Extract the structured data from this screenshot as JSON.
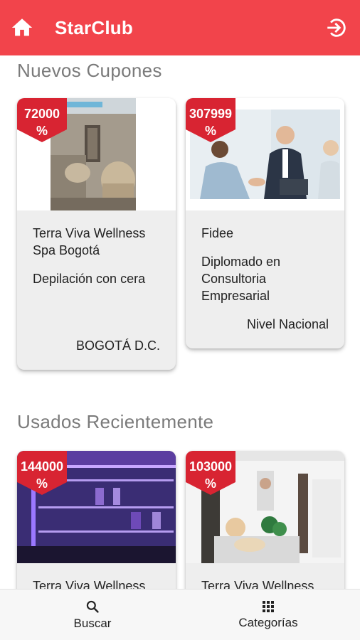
{
  "appbar": {
    "title": "StarClub",
    "home_icon": "home-icon",
    "logout_icon": "logout-icon",
    "color": "#f2444b"
  },
  "sections": {
    "new_coupons": {
      "title": "Nuevos Cupones"
    },
    "recent": {
      "title": "Usados Recientemente"
    }
  },
  "cards": [
    {
      "discount": "72000",
      "percent": "%",
      "merchant": "Terra Viva Wellness Spa Bogotá",
      "description": "Depilación con cera",
      "location": "BOGOTÁ D.C.",
      "image": "salon-interior-image"
    },
    {
      "discount": "307999",
      "percent": "%",
      "merchant": "Fidee",
      "description": "Diplomado en Consultoria Empresarial",
      "location": "Nivel Nacional",
      "image": "business-handshake-image"
    },
    {
      "discount": "144000",
      "percent": "%",
      "merchant": "Terra Viva Wellness",
      "image": "store-shelves-image"
    },
    {
      "discount": "103000",
      "percent": "%",
      "merchant": "Terra Viva Wellness",
      "image": "spa-reception-image"
    }
  ],
  "bottom_nav": [
    {
      "label": "Buscar",
      "icon": "search-icon"
    },
    {
      "label": "Categorías",
      "icon": "grid-icon"
    }
  ]
}
